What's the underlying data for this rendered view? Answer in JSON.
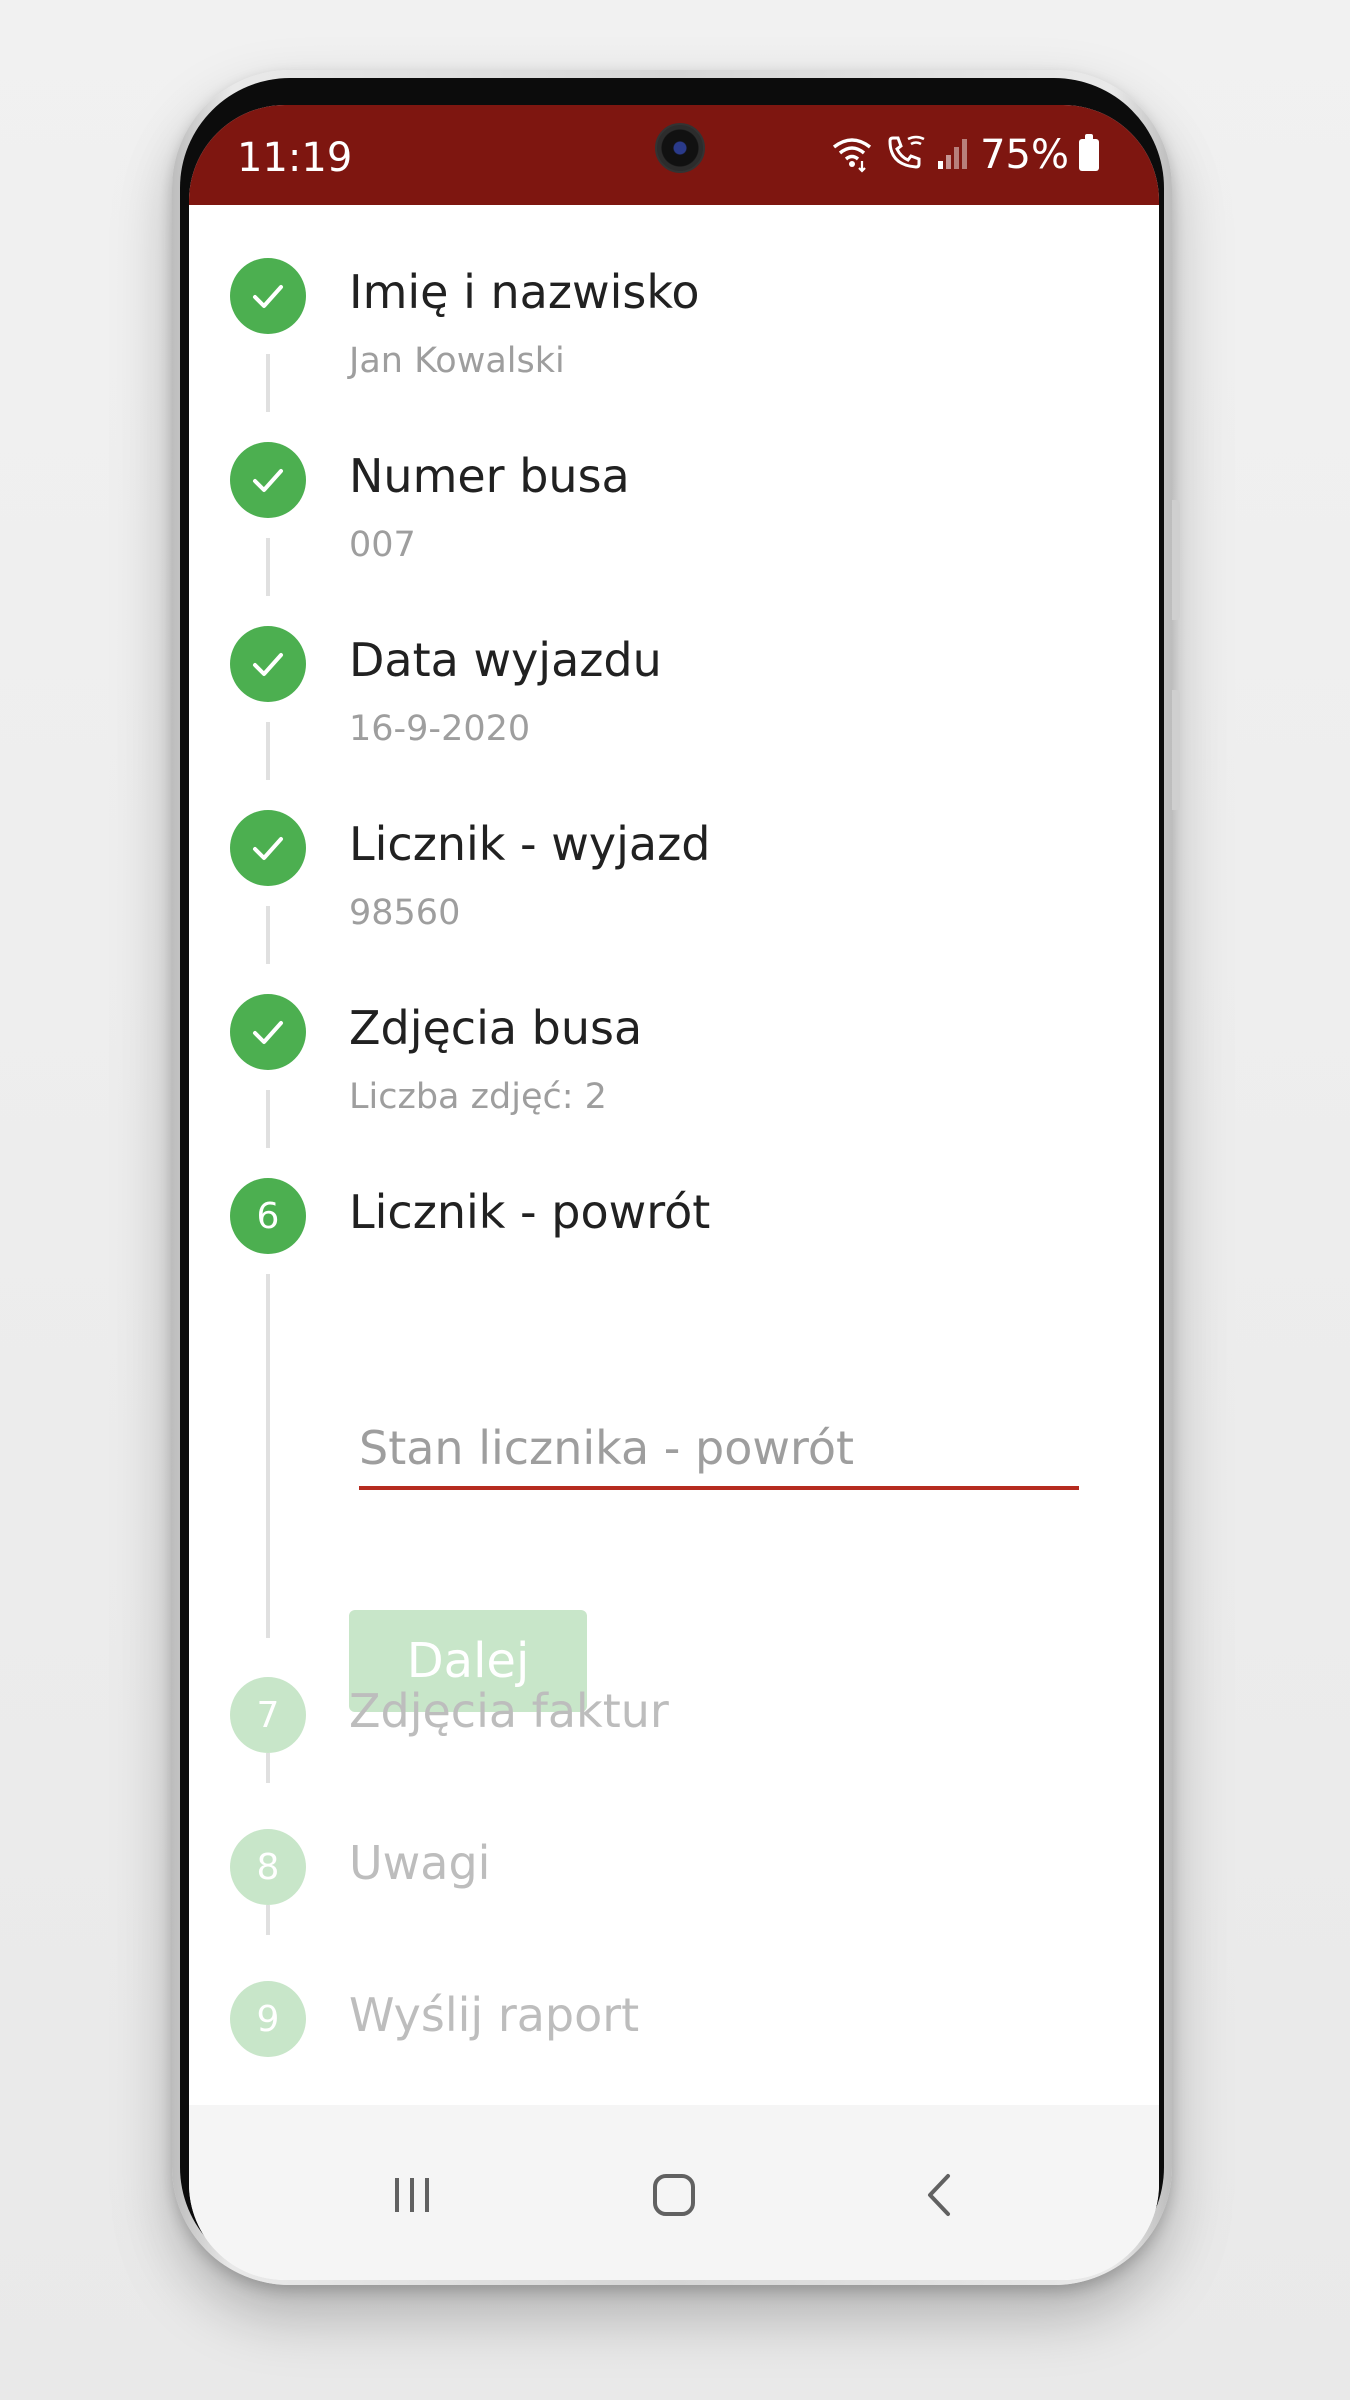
{
  "status_bar": {
    "time": "11:19",
    "battery_percent": "75%",
    "background_color": "#7e1610",
    "icons": [
      "wifi-icon",
      "wifi-calling-icon",
      "signal-icon",
      "battery-icon"
    ]
  },
  "stepper": {
    "accent_color": "#4caf50",
    "inactive_color": "#c8e6c9",
    "steps": [
      {
        "marker": "check",
        "title": "Imię i nazwisko",
        "value": "Jan Kowalski",
        "state": "completed"
      },
      {
        "marker": "check",
        "title": "Numer busa",
        "value": "007",
        "state": "completed"
      },
      {
        "marker": "check",
        "title": "Data wyjazdu",
        "value": "16-9-2020",
        "state": "completed"
      },
      {
        "marker": "check",
        "title": "Licznik - wyjazd",
        "value": "98560",
        "state": "completed"
      },
      {
        "marker": "check",
        "title": "Zdjęcia busa",
        "value": "Liczba zdjęć: 2",
        "state": "completed"
      },
      {
        "marker": "6",
        "title": "Licznik - powrót",
        "state": "active"
      },
      {
        "marker": "7",
        "title": "Zdjęcia faktur",
        "state": "inactive"
      },
      {
        "marker": "8",
        "title": "Uwagi",
        "state": "inactive"
      },
      {
        "marker": "9",
        "title": "Wyślij raport",
        "state": "inactive"
      }
    ],
    "active_step": {
      "input_placeholder": "Stan licznika - powrót",
      "input_value": "",
      "next_button_label": "Dalej"
    }
  },
  "nav_bar": {
    "icons": [
      "recent-apps-icon",
      "home-icon",
      "back-icon"
    ]
  }
}
